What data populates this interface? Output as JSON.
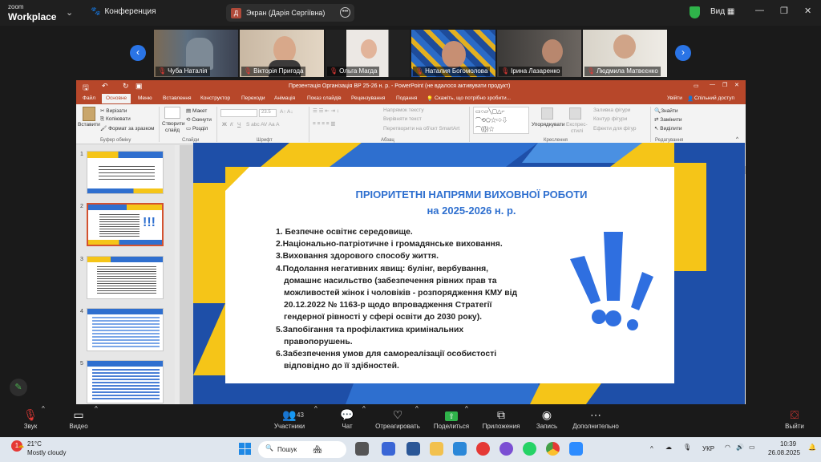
{
  "zoom": {
    "logo_top": "zoom",
    "logo_bottom": "Workplace",
    "conference_label": "Конференция",
    "share_tab": {
      "letter": "Д",
      "label": "Экран (Дарія Сергіївна)"
    },
    "view_label": "Вид",
    "participants_strip": [
      {
        "name": "Чуба Наталія"
      },
      {
        "name": "Вікторія Пригода"
      },
      {
        "name": "Ольга Магда"
      },
      {
        "name": "Наталия Богомолова"
      },
      {
        "name": "Ірина Лазаренко"
      },
      {
        "name": "Людмила Матвєєнко"
      }
    ],
    "toolbar": {
      "audio": "Звук",
      "video": "Видео",
      "participants": "Участники",
      "participants_count": "43",
      "chat": "Чат",
      "react": "Отреагировать",
      "share": "Поделиться",
      "apps": "Приложения",
      "record": "Запись",
      "more": "Дополнительно",
      "leave": "Выйти"
    }
  },
  "powerpoint": {
    "title": "Презентація Організація ВР 25-26 н. р. - PowerPoint (не вдалося активувати продукт)",
    "menu": [
      "Файл",
      "Основне",
      "Меню",
      "Вставлення",
      "Конструктор",
      "Переходи",
      "Анімація",
      "Показ слайдів",
      "Рецензування",
      "Подання"
    ],
    "menu_active": "Основне",
    "tell_me": "Скажіть, що потрібно зробити...",
    "login": "Увійти",
    "share": "Спільний доступ",
    "ribbon": {
      "paste": "Вставити",
      "cut": "Вирізати",
      "copy": "Копіювати",
      "format_painter": "Формат за зразком",
      "clipboard_group": "Буфер обміну",
      "new_slide_1": "Створити",
      "new_slide_2": "слайд",
      "layout": "Макет",
      "reset": "Скинути",
      "section": "Розділ",
      "slides_group": "Слайди",
      "font_size": "23.5",
      "font_group": "Шрифт",
      "text_direction": "Напрямок тексту",
      "align_text": "Вирівняти текст",
      "smartart": "Перетворити на об'єкт SmartArt",
      "paragraph_group": "Абзац",
      "arrange": "Упорядкувати",
      "quick_styles_1": "Експрес-",
      "quick_styles_2": "стилі",
      "shape_fill": "Заливка фігури",
      "shape_outline": "Контур фігури",
      "shape_effects": "Ефекти для фігур",
      "drawing_group": "Креслення",
      "find": "Знайти",
      "replace": "Замінити",
      "select": "Виділити",
      "editing_group": "Редагування"
    },
    "thumbnails": [
      "1",
      "2",
      "3",
      "4",
      "5"
    ],
    "selected_thumbnail": "2",
    "slide": {
      "title_line1": "ПРІОРИТЕТНІ НАПРЯМИ ВИХОВНОЇ РОБОТИ",
      "title_line2": "на 2025-2026 н. р.",
      "items": [
        "1. Безпечне освітнє середовище.",
        "2.Національно-патріотичне і громадянське виховання.",
        "3.Виховання здорового способу життя.",
        "4.Подолання негативних явищ: булінг, вербування,",
        "домашнє насильство (забезпечення рівних прав та",
        "можливостей жінок і чоловіків - розпорядження КМУ від",
        "20.12.2022 № 1163-р щодо впровадження Стратегії",
        "гендерної рівності у сфері освіти до 2030 року).",
        "5.Запобігання та профілактика кримінальних",
        "правопорушень.",
        "6.Забезпечення умов для самореалізації особистості",
        "відповідно до її здібностей."
      ]
    }
  },
  "taskbar": {
    "weather_temp": "21°C",
    "weather_desc": "Mostly cloudy",
    "weather_badge": "1",
    "search_placeholder": "Пошук",
    "language": "УКР",
    "time": "10:39",
    "date": "26.08.2025"
  }
}
